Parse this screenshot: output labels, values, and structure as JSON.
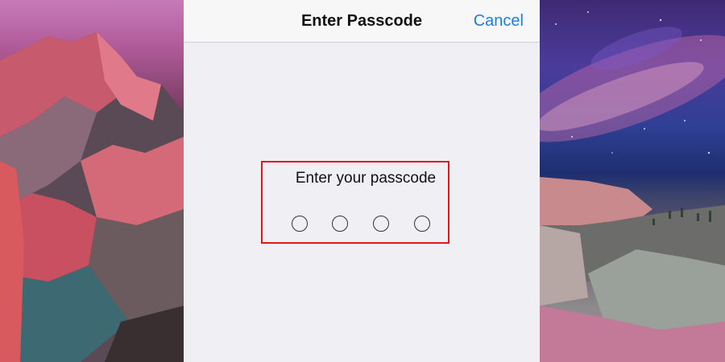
{
  "nav": {
    "title": "Enter Passcode",
    "cancel_label": "Cancel"
  },
  "prompt": {
    "text": "Enter your passcode"
  },
  "passcode": {
    "digits_total": 4,
    "digits_entered": 0
  },
  "colors": {
    "accent": "#1a7ee6",
    "highlight_border": "#e0161c",
    "screen_background": "#f0eff4"
  }
}
